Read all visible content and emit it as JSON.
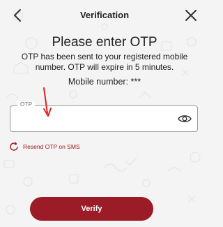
{
  "header": {
    "title": "Verification",
    "back_icon": "chevron-left-icon",
    "close_icon": "close-icon"
  },
  "main": {
    "heading": "Please enter OTP",
    "message": "OTP has been sent to your registered mobile number. OTP will expire in 5 minutes.",
    "mobile_number_label": "Mobile number: ***"
  },
  "otp_field": {
    "label": "OTP",
    "value": "",
    "toggle_icon": "eye-icon"
  },
  "resend": {
    "label": "Resend OTP on SMS",
    "icon": "refresh-icon"
  },
  "verify_button": {
    "label": "Verify"
  },
  "colors": {
    "accent": "#9b1b27",
    "link": "#a3141e",
    "annotation": "#e02020",
    "background": "#f4f4f4"
  }
}
